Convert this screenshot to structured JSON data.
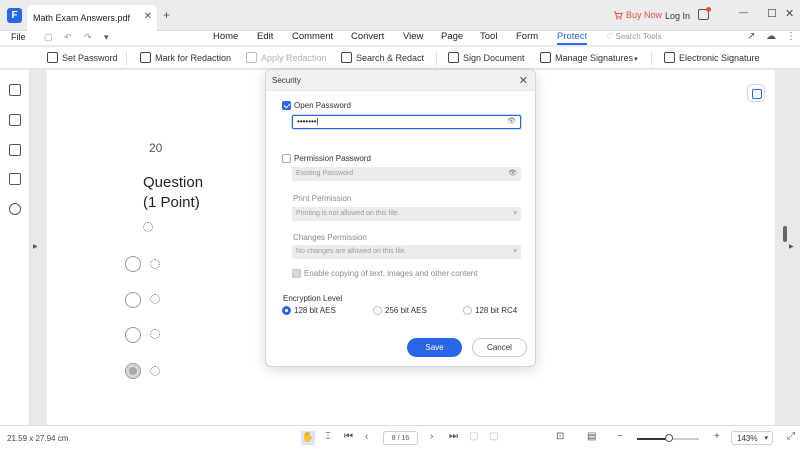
{
  "titlebar": {
    "tab_label": "Math Exam Answers.pdf",
    "close_glyph": "✕",
    "new_tab_glyph": "+",
    "buy_now": "Buy Now",
    "login": "Log In",
    "minimize": "—",
    "maximize": "☐",
    "close": "✕",
    "accent_color": "#2a66e8",
    "buy_color": "#e8503a"
  },
  "menubar": {
    "file": "File",
    "tabs": [
      {
        "label": "Home"
      },
      {
        "label": "Edit"
      },
      {
        "label": "Comment"
      },
      {
        "label": "Convert"
      },
      {
        "label": "View"
      },
      {
        "label": "Page"
      },
      {
        "label": "Tool"
      },
      {
        "label": "Form"
      },
      {
        "label": "Protect",
        "active": true
      }
    ],
    "search_tools": "Search Tools"
  },
  "ribbon": {
    "items": [
      {
        "label": "Set Password"
      },
      {
        "label": "Mark for Redaction"
      },
      {
        "label": "Apply Redaction",
        "disabled": true
      },
      {
        "label": "Search & Redact"
      },
      {
        "label": "Sign Document"
      },
      {
        "label": "Manage Signatures"
      },
      {
        "label": "Electronic Signature"
      }
    ]
  },
  "document": {
    "question_number": "20",
    "question_title_line1": "Question",
    "question_title_line2": "(1 Point)"
  },
  "dialog": {
    "title": "Security",
    "close_glyph": "✕",
    "open_password": {
      "label": "Open Password",
      "checked": true,
      "value": "•••••••"
    },
    "permission_password": {
      "label": "Permission Password",
      "checked": false,
      "placeholder": "Existing Password"
    },
    "print_permission": {
      "label": "Print Permission",
      "value": "Printing is not allowed on this file."
    },
    "changes_permission": {
      "label": "Changes Permission",
      "value": "No changes are allowed on this file."
    },
    "copy_option": "Enable copying of text, images and other content",
    "encryption_level": {
      "label": "Encryption Level",
      "options": [
        {
          "label": "128 bit AES",
          "selected": true
        },
        {
          "label": "256 bit AES",
          "selected": false
        },
        {
          "label": "128 bit RC4",
          "selected": false
        }
      ]
    },
    "save": "Save",
    "cancel": "Cancel"
  },
  "statusbar": {
    "dimensions": "21.59 x 27.94 cm",
    "page_indicator": "8 / 16",
    "zoom": "143%",
    "zoom_slider_fraction": 0.52
  }
}
